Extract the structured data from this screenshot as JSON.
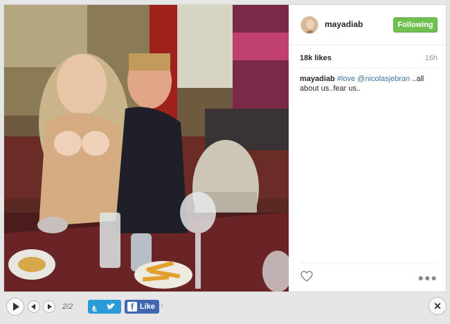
{
  "profile": {
    "username": "mayadiab",
    "follow_label": "Following"
  },
  "post": {
    "likes": "18k likes",
    "time": "16h",
    "caption_user": "mayadiab",
    "caption_tag": "#love",
    "caption_mention": "@nicolasjebran",
    "caption_text": " ..all about us..fear us.."
  },
  "viewer": {
    "counter": "2/2",
    "fb_label": "Like",
    "close_glyph": "✕"
  },
  "icons": [
    "heart-icon",
    "more-icon",
    "play-icon",
    "prev-icon",
    "next-icon",
    "twitter-icon",
    "facebook-icon",
    "close-icon"
  ]
}
